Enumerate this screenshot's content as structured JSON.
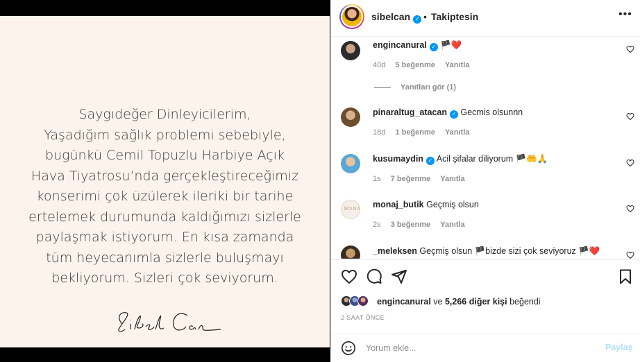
{
  "post": {
    "announcement_lines": [
      "Saygıdeğer Dinleyicilerim,",
      "Yaşadığım sağlık problemi sebebiyle,",
      "bugünkü Cemil Topuzlu Harbiye Açık",
      "Hava Tiyatrosu’nda gerçekleştireceğimiz",
      "konserimi çok üzülerek ileriki bir tarihe",
      "ertelemek durumunda kaldığımızı sizlerle",
      "paylaşmak istiyorum. En kısa zamanda",
      "tüm heyecanımla sizlerle buluşmayı",
      "bekliyorum. Sizleri çok seviyorum."
    ],
    "signature": "Sibel Can",
    "background_color": "#fcf3ed"
  },
  "header": {
    "username": "sibelcan",
    "separator": "•",
    "follow_status": "Takiptesin",
    "more_icon": "more-horizontal-icon"
  },
  "comments": [
    {
      "username": "engincanural",
      "verified": true,
      "text": "🏴❤️",
      "age": "40d",
      "likes": "5 beğenme",
      "reply": "Yanıtla",
      "view_replies": "Yanıtları gör (1)"
    },
    {
      "username": "pinaraltug_atacan",
      "verified": true,
      "text": "Gecmis olsunnn",
      "age": "18d",
      "likes": "1 beğenme",
      "reply": "Yanıtla"
    },
    {
      "username": "kusumaydin",
      "verified": true,
      "text": "Acil şifalar diliyorum 🏴🤲🙏",
      "age": "1s",
      "likes": "7 beğenme",
      "reply": "Yanıtla"
    },
    {
      "username": "monaj_butik",
      "verified": false,
      "text": "Geçmiş olsun",
      "age": "2s",
      "likes": "3 beğenme",
      "reply": "Yanıtla"
    },
    {
      "username": "_meleksen",
      "verified": false,
      "text": "Geçmiş olsun 🏴bizde sizi çok seviyoruz 🏴❤️"
    }
  ],
  "likes_summary": {
    "first_user": "engincanural",
    "connector": "ve",
    "others": "5,266 diğer kişi",
    "suffix": "beğendi"
  },
  "timestamp": "2 SAAT ÖNCE",
  "comment_box": {
    "placeholder": "Yorum ekle...",
    "share_label": "Paylaş"
  },
  "colors": {
    "accent_blue": "#0095f6",
    "share_disabled": "#b2dffc",
    "meta_gray": "#8e8e8e"
  }
}
